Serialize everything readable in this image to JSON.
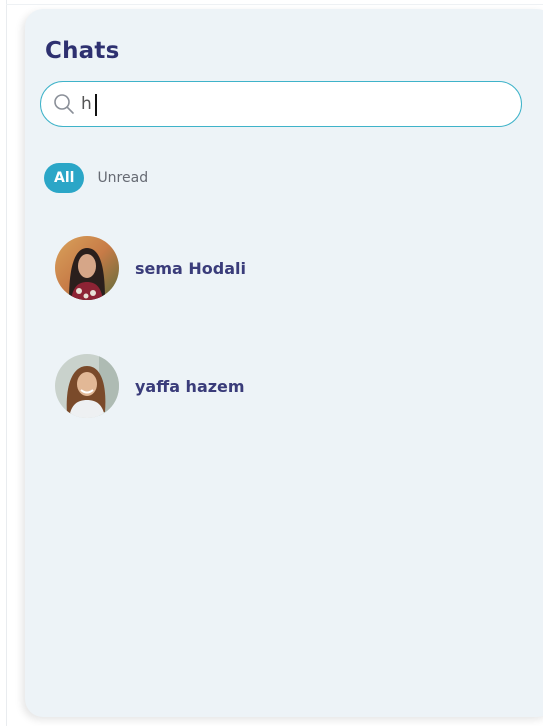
{
  "panel": {
    "title": "Chats"
  },
  "search": {
    "value": "h",
    "icon": "search-icon"
  },
  "filters": {
    "all_label": "All",
    "unread_label": "Unread"
  },
  "chats": [
    {
      "name": "sema Hodali",
      "avatar_icon": "avatar-photo"
    },
    {
      "name": "yaffa hazem",
      "avatar_icon": "avatar-photo"
    }
  ],
  "colors": {
    "accent": "#2ba6c7",
    "search_border": "#3fb3c9",
    "title": "#2e3070",
    "panel_bg": "#edf3f7"
  }
}
